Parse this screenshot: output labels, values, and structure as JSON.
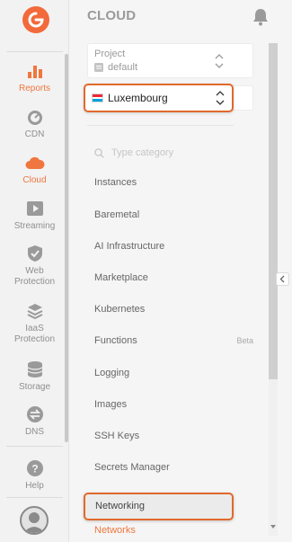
{
  "rail": {
    "items": [
      {
        "label": "Reports",
        "icon": "bar-chart-icon"
      },
      {
        "label": "CDN",
        "icon": "speedometer-icon"
      },
      {
        "label": "Cloud",
        "icon": "cloud-icon"
      },
      {
        "label": "Streaming",
        "icon": "play-icon"
      },
      {
        "label": "Web\nProtection",
        "icon": "shield-icon"
      },
      {
        "label": "IaaS\nProtection",
        "icon": "layers-icon"
      },
      {
        "label": "Storage",
        "icon": "database-icon"
      },
      {
        "label": "DNS",
        "icon": "swap-icon"
      },
      {
        "label": "Help",
        "icon": "help-icon"
      }
    ],
    "active": "Cloud"
  },
  "panel": {
    "title": "CLOUD",
    "project": {
      "label": "Project",
      "value": "default"
    },
    "region": {
      "value": "Luxembourg"
    },
    "search": {
      "placeholder": "Type category"
    },
    "menu": [
      {
        "label": "Instances",
        "badge": ""
      },
      {
        "label": "Baremetal",
        "badge": ""
      },
      {
        "label": "AI Infrastructure",
        "badge": ""
      },
      {
        "label": "Marketplace",
        "badge": ""
      },
      {
        "label": "Kubernetes",
        "badge": ""
      },
      {
        "label": "Functions",
        "badge": "Beta"
      },
      {
        "label": "Logging",
        "badge": ""
      },
      {
        "label": "Images",
        "badge": ""
      },
      {
        "label": "SSH Keys",
        "badge": ""
      },
      {
        "label": "Secrets Manager",
        "badge": ""
      }
    ],
    "selected": "Networking",
    "subitem": "Networks"
  },
  "colors": {
    "accent": "#f0763f",
    "highlight_border": "#e06a2c"
  }
}
